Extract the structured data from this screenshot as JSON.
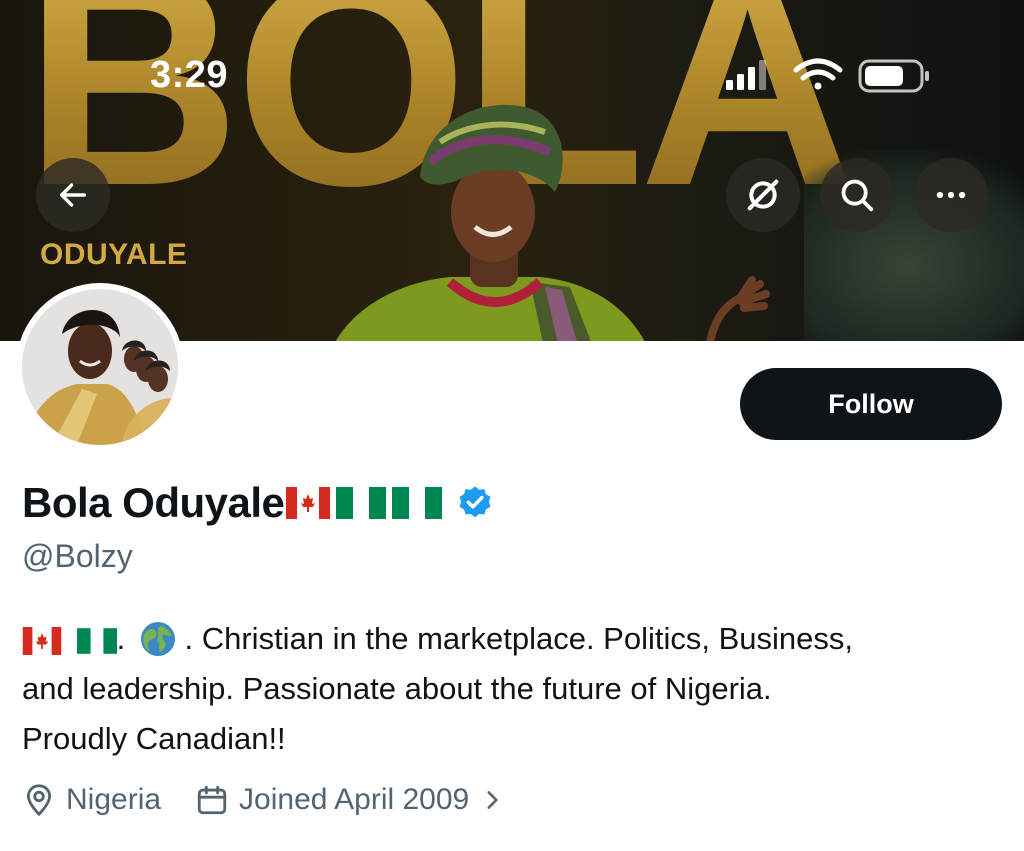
{
  "status_bar": {
    "time": "3:29"
  },
  "banner": {
    "title_text": "BOLA",
    "subtitle_text": "ODUYALE"
  },
  "nav": {
    "back_icon": "arrow-left-icon",
    "grok_icon": "grok-icon",
    "search_icon": "search-icon",
    "more_icon": "ellipsis-icon"
  },
  "profile": {
    "display_name": "Bola Oduyale",
    "name_flags": [
      "flag-canada",
      "flag-nigeria",
      "flag-nigeria"
    ],
    "verified_icon": "verified-badge-icon",
    "handle": "@Bolzy",
    "bio": {
      "line1_text": ". Christian in the marketplace. Politics, Business,",
      "line1_symbols": [
        "flag-canada",
        "flag-nigeria",
        "globe-icon"
      ],
      "line2": "and leadership. Passionate about the future of Nigeria.",
      "line3": "Proudly Canadian!!"
    },
    "location": "Nigeria",
    "joined": "Joined April 2009"
  },
  "actions": {
    "follow_label": "Follow"
  },
  "colors": {
    "follow_bg": "#0f1419",
    "secondary_text": "#536471",
    "verified_blue": "#1d9bf0",
    "banner_gold": "#c9a13c"
  }
}
